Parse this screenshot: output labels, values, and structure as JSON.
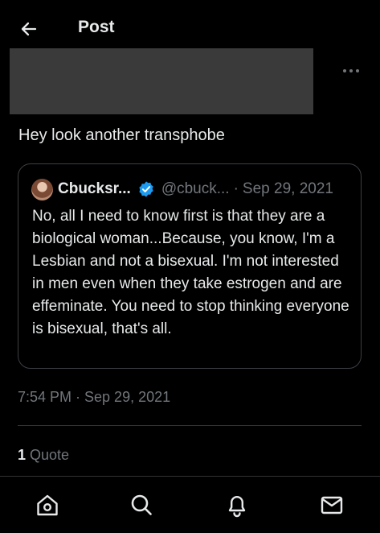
{
  "header": {
    "title": "Post",
    "back_icon": "arrow-left-icon"
  },
  "post": {
    "text": "Hey look another transphobe",
    "more_icon": "more-horizontal-icon",
    "timestamp": "7:54 PM · Sep 29, 2021",
    "quote_count": "1",
    "quote_label": "Quote"
  },
  "quoted": {
    "name": "Cbucksr...",
    "handle": "@cbuck...",
    "separator": "·",
    "date": "Sep 29, 2021",
    "verified_color": "#1d9bf0",
    "body": "No, all I need to know first is that they are a biological woman...Because, you know, I'm a Lesbian and not a bisexual. I'm not interested in men even when they take estrogen and are effeminate. You need to stop thinking everyone is bisexual, that's all."
  },
  "nav": {
    "items": [
      "home-icon",
      "search-icon",
      "bell-icon",
      "mail-icon"
    ]
  },
  "colors": {
    "background": "#000000",
    "text": "#e7e9ea",
    "secondary": "#71767b",
    "border": "#2f3336"
  }
}
